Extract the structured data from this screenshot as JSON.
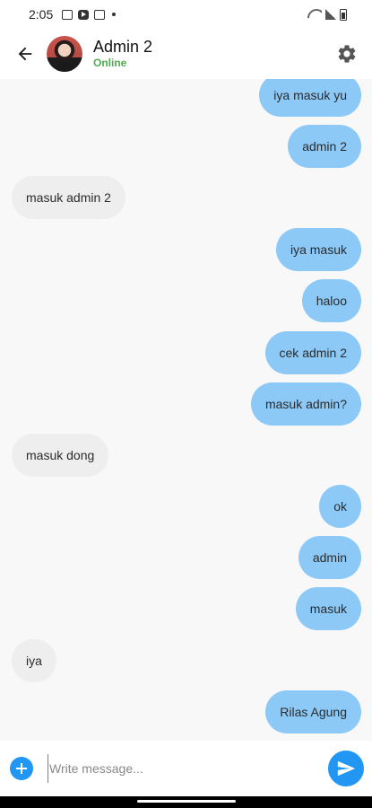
{
  "status_bar": {
    "time": "2:05"
  },
  "contact": {
    "name": "Admin 2",
    "status": "Online"
  },
  "messages": [
    {
      "text": "iya masuk yu",
      "type": "sent"
    },
    {
      "text": "admin 2",
      "type": "sent"
    },
    {
      "text": "masuk admin 2",
      "type": "received"
    },
    {
      "text": "iya masuk",
      "type": "sent"
    },
    {
      "text": "haloo",
      "type": "sent"
    },
    {
      "text": "cek admin 2",
      "type": "sent"
    },
    {
      "text": "masuk admin?",
      "type": "sent"
    },
    {
      "text": "masuk dong",
      "type": "received"
    },
    {
      "text": "ok",
      "type": "sent"
    },
    {
      "text": "admin",
      "type": "sent"
    },
    {
      "text": "masuk",
      "type": "sent"
    },
    {
      "text": "iya",
      "type": "received"
    },
    {
      "text": "Rilas Agung",
      "type": "sent"
    }
  ],
  "composer": {
    "placeholder": "Write message...",
    "value": ""
  },
  "colors": {
    "accent": "#2196f3",
    "sent_bubble": "#8cc9f7",
    "received_bubble": "#eeeeee",
    "online": "#4caf50"
  }
}
